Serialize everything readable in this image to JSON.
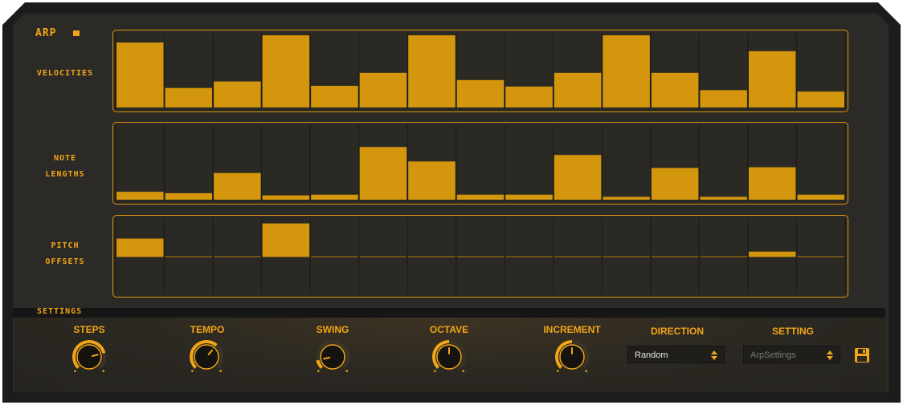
{
  "title": "ARP",
  "rows": {
    "velocities": "VELOCITIES",
    "note_lengths_1": "NOTE",
    "note_lengths_2": "LENGTHS",
    "pitch_offsets_1": "PITCH",
    "pitch_offsets_2": "OFFSETS"
  },
  "velocities": [
    0.9,
    0.27,
    0.36,
    1.0,
    0.3,
    0.48,
    1.0,
    0.38,
    0.29,
    0.48,
    1.0,
    0.48,
    0.24,
    0.78,
    0.22
  ],
  "note_lengths": [
    0.11,
    0.09,
    0.37,
    0.06,
    0.07,
    0.73,
    0.53,
    0.07,
    0.07,
    0.62,
    0.04,
    0.44,
    0.04,
    0.45,
    0.07
  ],
  "pitch_offsets": [
    0.5,
    0.0,
    0.0,
    0.92,
    0.0,
    0.0,
    0.0,
    0.0,
    0.0,
    0.0,
    0.0,
    0.0,
    0.0,
    0.14,
    0.0
  ],
  "settings_label": "SETTINGS",
  "controls": {
    "steps": {
      "label": "STEPS",
      "value": 0.78
    },
    "tempo": {
      "label": "TEMPO",
      "value": 0.65
    },
    "swing": {
      "label": "SWING",
      "value": 0.12
    },
    "octave": {
      "label": "OCTAVE",
      "value": 0.5
    },
    "increment": {
      "label": "INCREMENT",
      "value": 0.5
    }
  },
  "direction": {
    "label": "DIRECTION",
    "value": "Random"
  },
  "setting": {
    "label": "SETTING",
    "value": "ArpSettings"
  },
  "colors": {
    "accent": "#f2a516",
    "bar": "#d3960c",
    "panel_border": "#e0940f"
  }
}
